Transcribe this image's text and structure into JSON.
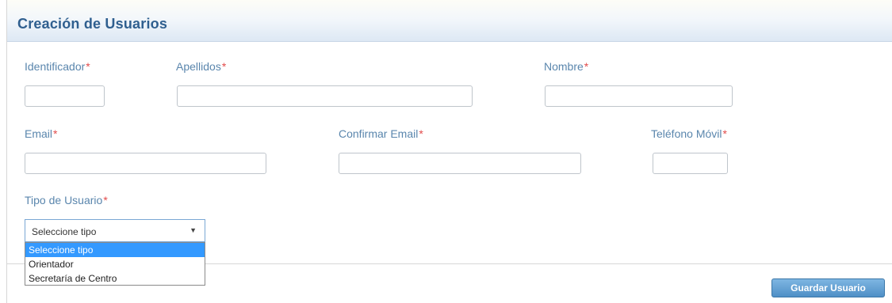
{
  "form": {
    "title": "Creación de Usuarios",
    "required_mark": "*",
    "fields": {
      "identificador": {
        "label": "Identificador",
        "value": ""
      },
      "apellidos": {
        "label": "Apellidos",
        "value": ""
      },
      "nombre": {
        "label": "Nombre",
        "value": ""
      },
      "email": {
        "label": "Email",
        "value": ""
      },
      "confirmar_email": {
        "label": "Confirmar Email",
        "value": ""
      },
      "telefono_movil": {
        "label": "Teléfono Móvil",
        "value": ""
      }
    },
    "tipo_usuario": {
      "label": "Tipo de Usuario",
      "selected": "Seleccione tipo",
      "options": [
        "Seleccione tipo",
        "Orientador",
        "Secretaría de Centro"
      ]
    },
    "save_label": "Guardar Usuario"
  },
  "colors": {
    "title": "#2f5f8f",
    "label": "#5a86ad",
    "required": "#e24b4b",
    "highlight": "#3399ff",
    "button": "#4f8fc6"
  },
  "icons": {
    "select_arrow": "triangle-down-icon"
  }
}
